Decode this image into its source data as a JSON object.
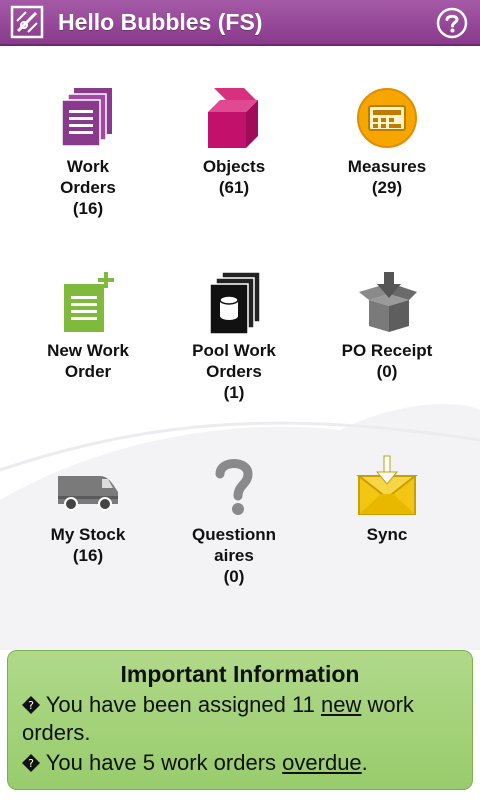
{
  "app": {
    "title": "Hello Bubbles (FS)"
  },
  "tiles": [
    {
      "label": "Work\nOrders",
      "count": "(16)",
      "icon": "work-orders-icon"
    },
    {
      "label": "Objects",
      "count": "(61)",
      "icon": "objects-icon"
    },
    {
      "label": "Measures",
      "count": "(29)",
      "icon": "measures-icon"
    },
    {
      "label": "New Work\nOrder",
      "count": "",
      "icon": "new-work-order-icon"
    },
    {
      "label": "Pool Work\nOrders",
      "count": "(1)",
      "icon": "pool-work-orders-icon"
    },
    {
      "label": "PO Receipt",
      "count": "(0)",
      "icon": "po-receipt-icon"
    },
    {
      "label": "My Stock",
      "count": "(16)",
      "icon": "van-icon"
    },
    {
      "label": "Questionn\naires",
      "count": "(0)",
      "icon": "question-icon"
    },
    {
      "label": "Sync",
      "count": "",
      "icon": "sync-envelope-icon"
    }
  ],
  "info": {
    "title": "Important Information",
    "line1_pre": "You have been assigned 11 ",
    "line1_link": "new",
    "line1_post": " work orders.",
    "line2_pre": "You have 5 work orders ",
    "line2_link": "overdue",
    "line2_post": "."
  },
  "colors": {
    "titlebar": "#8a3a8c",
    "purple": "#8a3a8c",
    "magenta": "#c3106b",
    "orange": "#f7a600",
    "green": "#7fba3c",
    "gray": "#7a7a7a",
    "info_bg": "#a4d37a"
  }
}
